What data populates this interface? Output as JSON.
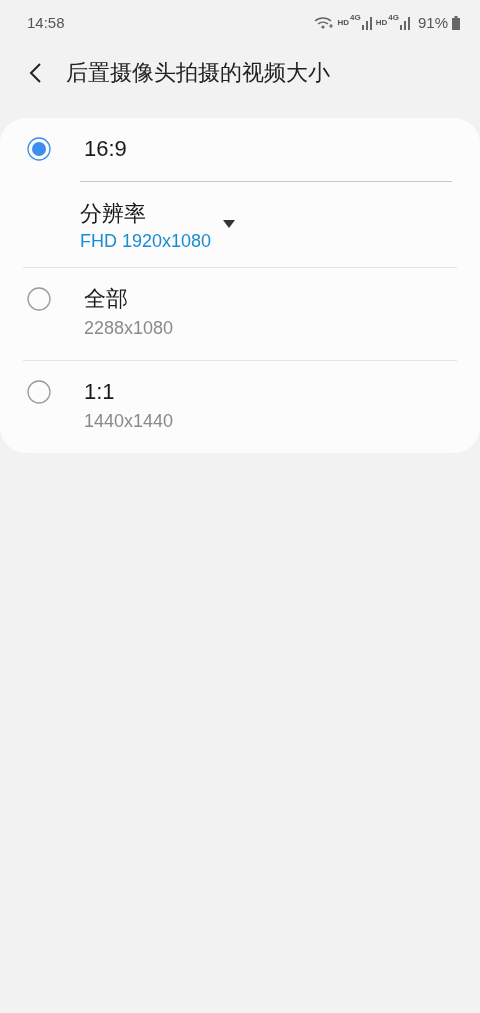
{
  "status_bar": {
    "time": "14:58",
    "network": [
      {
        "label": "HD",
        "tech": "4G"
      },
      {
        "label": "HD",
        "tech": "4G"
      }
    ],
    "battery": "91%"
  },
  "header": {
    "title": "后置摄像头拍摄的视频大小"
  },
  "options": [
    {
      "label": "16:9",
      "selected": true,
      "setting": {
        "label": "分辨率",
        "value": "FHD 1920x1080"
      }
    },
    {
      "label": "全部",
      "selected": false,
      "detail": "2288x1080"
    },
    {
      "label": "1:1",
      "selected": false,
      "detail": "1440x1440"
    }
  ]
}
